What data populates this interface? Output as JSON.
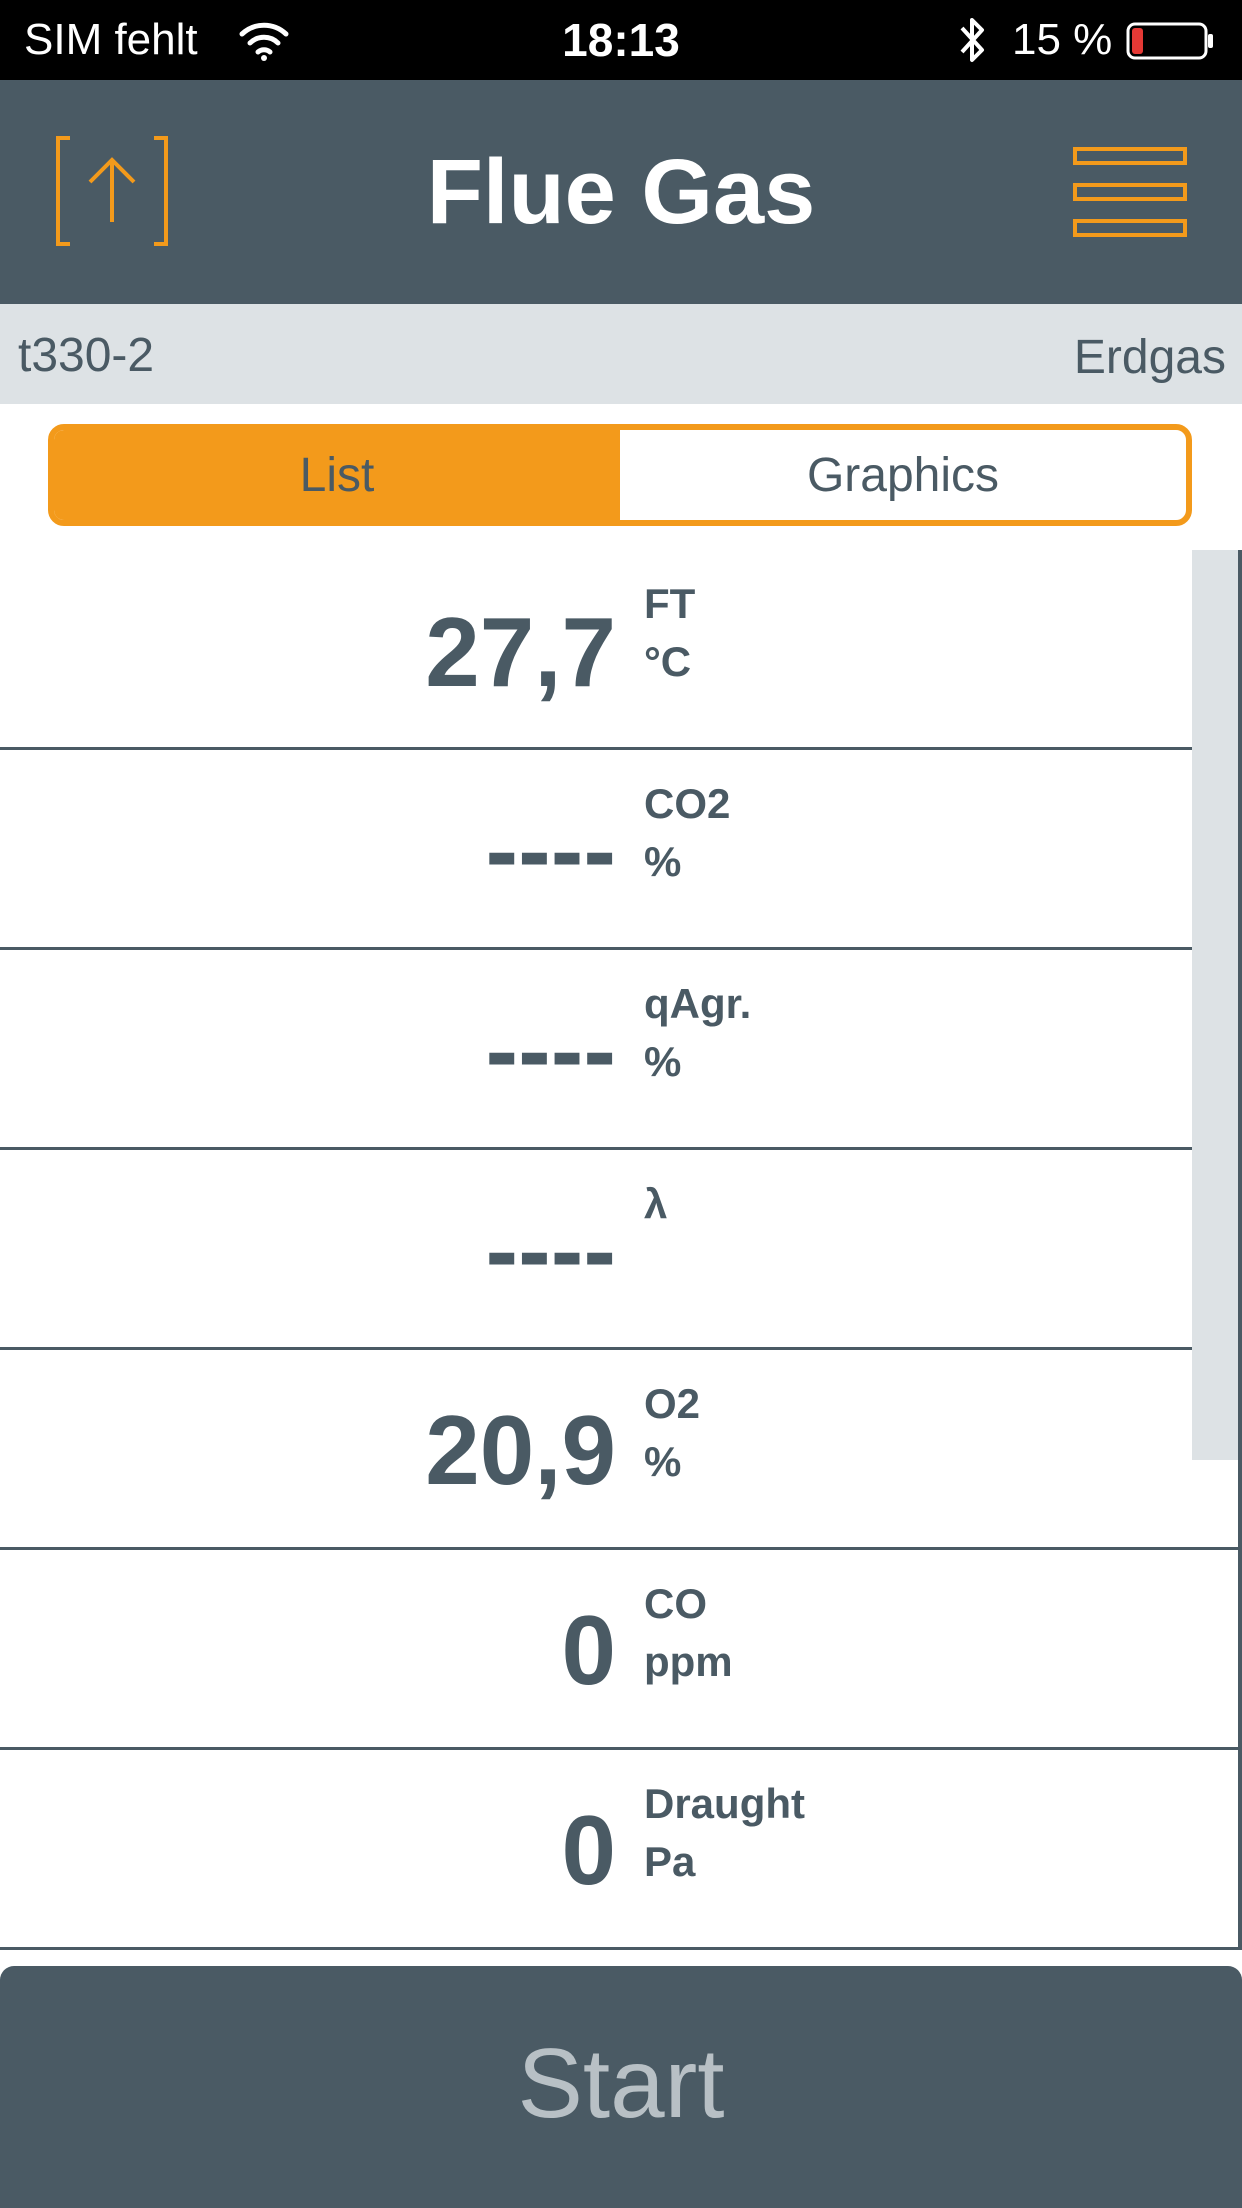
{
  "status_bar": {
    "carrier": "SIM fehlt",
    "time": "18:13",
    "battery_percent": "15 %",
    "battery_level": 0.15,
    "icons": [
      "wifi-icon",
      "bluetooth-icon",
      "battery-icon"
    ]
  },
  "header": {
    "title": "Flue Gas",
    "left_icon": "export-icon",
    "right_icon": "hamburger-menu-icon"
  },
  "info_bar": {
    "device": "t330-2",
    "fuel": "Erdgas"
  },
  "tabs": [
    {
      "label": "List",
      "active": true
    },
    {
      "label": "Graphics",
      "active": false
    }
  ],
  "measurements": [
    {
      "value": "27,7",
      "name": "FT",
      "unit": "°C"
    },
    {
      "value": "----",
      "name": "CO2",
      "unit": "%"
    },
    {
      "value": "----",
      "name": "qAgr.",
      "unit": "%"
    },
    {
      "value": "----",
      "name": "λ",
      "unit": ""
    },
    {
      "value": "20,9",
      "name": "O2",
      "unit": "%"
    },
    {
      "value": "0",
      "name": "CO",
      "unit": "ppm"
    },
    {
      "value": "0",
      "name": "Draught",
      "unit": "Pa"
    }
  ],
  "start_button": {
    "label": "Start"
  },
  "colors": {
    "accent": "#f39a1b",
    "header_bg": "#4a5a64",
    "info_bg": "#dde2e5",
    "text": "#4a5a64"
  }
}
